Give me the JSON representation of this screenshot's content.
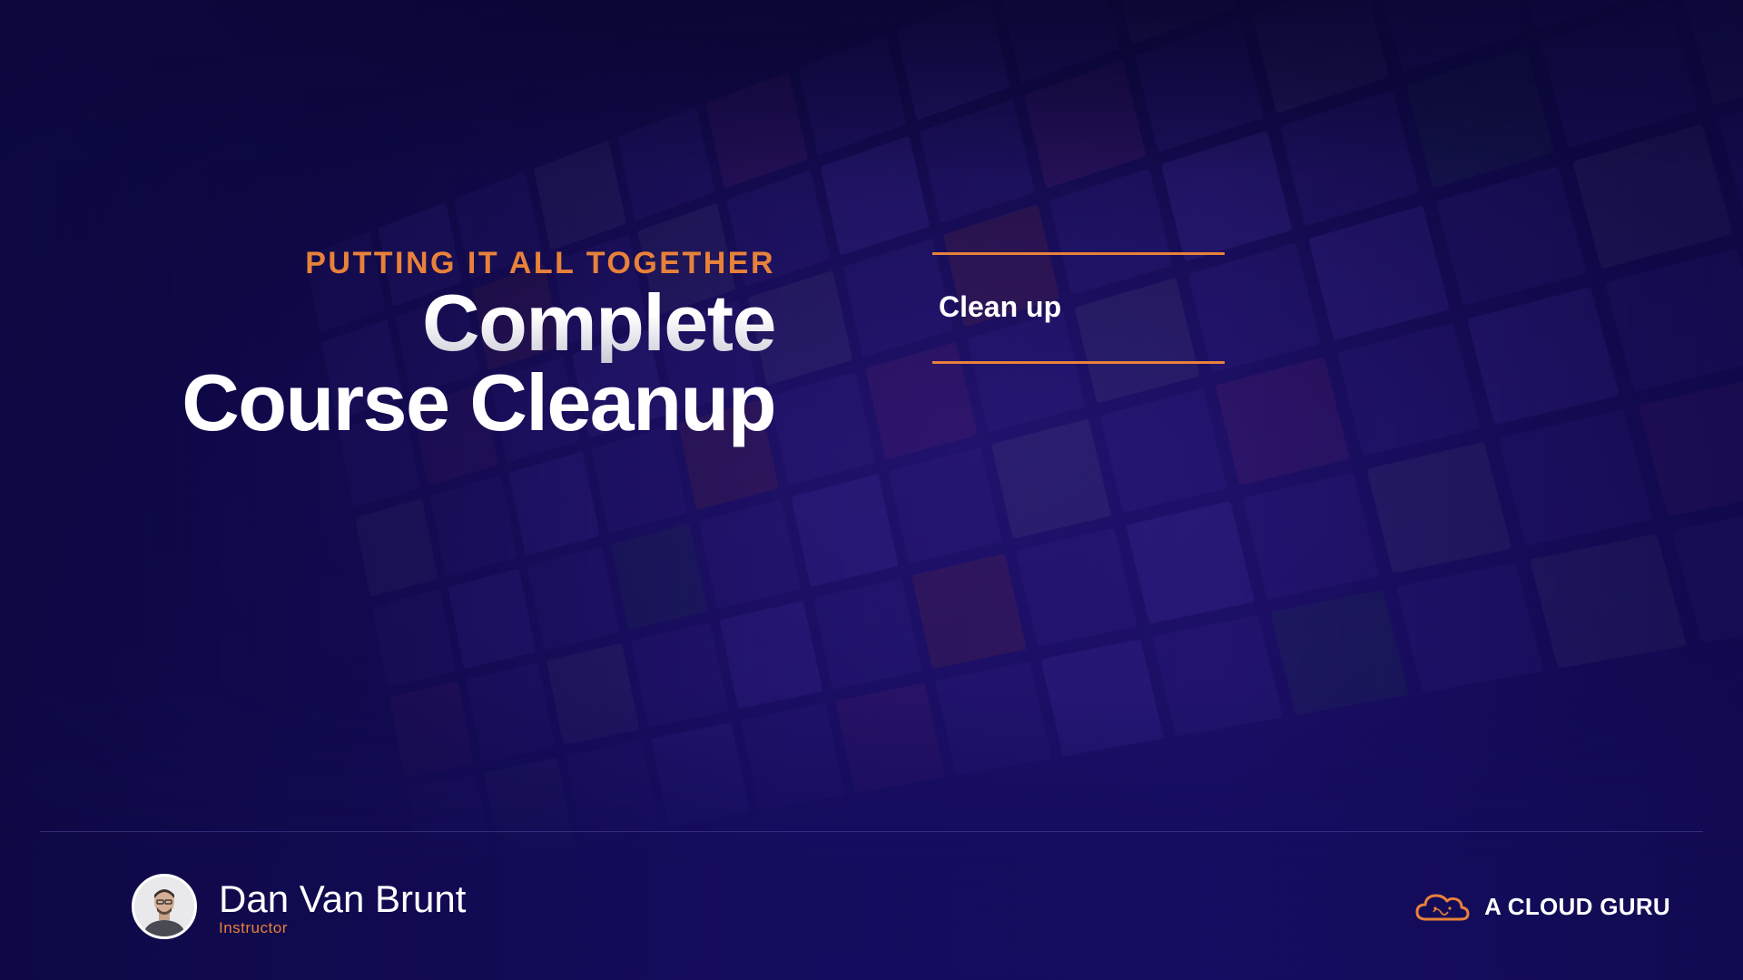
{
  "slide": {
    "section_label": "PUTTING IT ALL TOGETHER",
    "title_line1": "Complete",
    "title_line2": "Course Cleanup"
  },
  "agenda": {
    "items": [
      "Clean up"
    ]
  },
  "instructor": {
    "name": "Dan Van Brunt",
    "role": "Instructor"
  },
  "brand": {
    "name": "A CLOUD GURU",
    "logo_icon": "cloud-logo-icon"
  },
  "colors": {
    "accent": "#e8813a",
    "background": "#0d0840",
    "text": "#ffffff"
  }
}
